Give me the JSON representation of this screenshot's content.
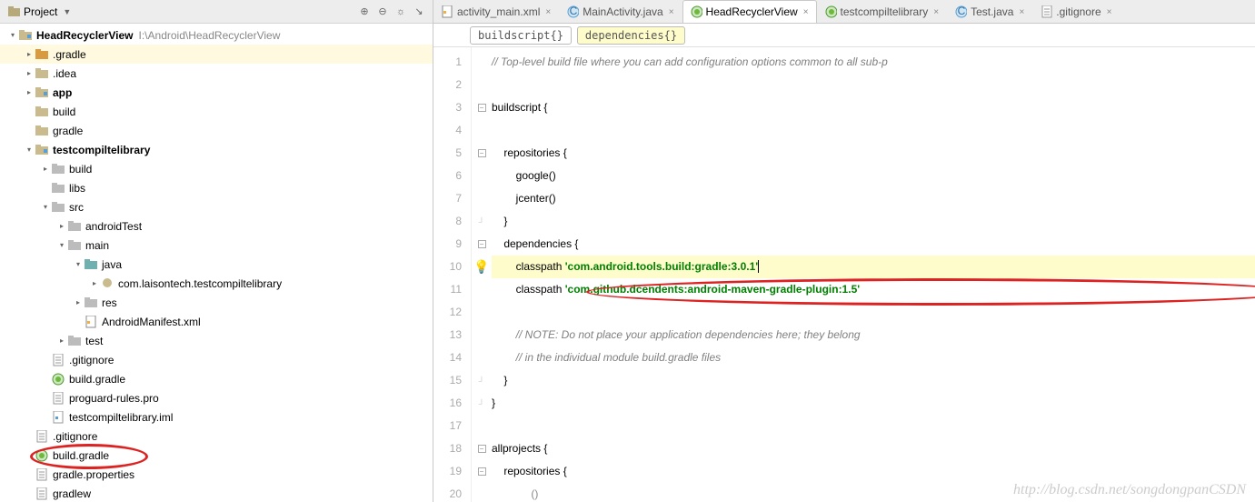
{
  "panel": {
    "title": "Project",
    "root_name": "HeadRecyclerView",
    "root_path": "I:\\Android\\HeadRecyclerView"
  },
  "tree": [
    {
      "depth": 0,
      "arrow": "down",
      "icon": "module",
      "label": "HeadRecyclerView",
      "bold": true,
      "path": "I:\\Android\\HeadRecyclerView"
    },
    {
      "depth": 1,
      "arrow": "right",
      "icon": "folder-orange",
      "label": ".gradle",
      "selected": true
    },
    {
      "depth": 1,
      "arrow": "right",
      "icon": "folder",
      "label": ".idea"
    },
    {
      "depth": 1,
      "arrow": "right",
      "icon": "module",
      "label": "app",
      "bold": true
    },
    {
      "depth": 1,
      "arrow": "",
      "icon": "folder",
      "label": "build"
    },
    {
      "depth": 1,
      "arrow": "",
      "icon": "folder",
      "label": "gradle"
    },
    {
      "depth": 1,
      "arrow": "down",
      "icon": "module",
      "label": "testcompiltelibrary",
      "bold": true
    },
    {
      "depth": 2,
      "arrow": "right",
      "icon": "folder-gray",
      "label": "build"
    },
    {
      "depth": 2,
      "arrow": "",
      "icon": "folder-gray",
      "label": "libs"
    },
    {
      "depth": 2,
      "arrow": "down",
      "icon": "folder-gray",
      "label": "src"
    },
    {
      "depth": 3,
      "arrow": "right",
      "icon": "folder-gray",
      "label": "androidTest"
    },
    {
      "depth": 3,
      "arrow": "down",
      "icon": "folder-gray",
      "label": "main"
    },
    {
      "depth": 4,
      "arrow": "down",
      "icon": "folder-teal",
      "label": "java"
    },
    {
      "depth": 5,
      "arrow": "right",
      "icon": "package",
      "label": "com.laisontech.testcompiltelibrary"
    },
    {
      "depth": 4,
      "arrow": "right",
      "icon": "folder-gray",
      "label": "res"
    },
    {
      "depth": 4,
      "arrow": "",
      "icon": "xml",
      "label": "AndroidManifest.xml"
    },
    {
      "depth": 3,
      "arrow": "right",
      "icon": "folder-gray",
      "label": "test"
    },
    {
      "depth": 2,
      "arrow": "",
      "icon": "file",
      "label": ".gitignore"
    },
    {
      "depth": 2,
      "arrow": "",
      "icon": "gradle",
      "label": "build.gradle"
    },
    {
      "depth": 2,
      "arrow": "",
      "icon": "file",
      "label": "proguard-rules.pro"
    },
    {
      "depth": 2,
      "arrow": "",
      "icon": "iml",
      "label": "testcompiltelibrary.iml"
    },
    {
      "depth": 1,
      "arrow": "",
      "icon": "file",
      "label": ".gitignore"
    },
    {
      "depth": 1,
      "arrow": "",
      "icon": "gradle",
      "label": "build.gradle"
    },
    {
      "depth": 1,
      "arrow": "",
      "icon": "file",
      "label": "gradle.properties"
    },
    {
      "depth": 1,
      "arrow": "",
      "icon": "file",
      "label": "gradlew"
    }
  ],
  "tabs": [
    {
      "icon": "xml",
      "label": "activity_main.xml",
      "active": false
    },
    {
      "icon": "java",
      "label": "MainActivity.java",
      "active": false
    },
    {
      "icon": "gradle",
      "label": "HeadRecyclerView",
      "active": true
    },
    {
      "icon": "gradle",
      "label": "testcompiltelibrary",
      "active": false
    },
    {
      "icon": "java",
      "label": "Test.java",
      "active": false
    },
    {
      "icon": "file",
      "label": ".gitignore",
      "active": false
    }
  ],
  "breadcrumb": [
    {
      "text": "buildscript{}",
      "active": false
    },
    {
      "text": "dependencies{}",
      "active": true
    }
  ],
  "code": {
    "lines": [
      {
        "n": 1,
        "html": "<span class='comment'>// Top-level build file where you can add configuration options common to all sub-p</span>"
      },
      {
        "n": 2,
        "html": ""
      },
      {
        "n": 3,
        "html": "buildscript {",
        "fold": "open"
      },
      {
        "n": 4,
        "html": ""
      },
      {
        "n": 5,
        "html": "    repositories {",
        "fold": "open"
      },
      {
        "n": 6,
        "html": "        google()"
      },
      {
        "n": 7,
        "html": "        jcenter()"
      },
      {
        "n": 8,
        "html": "    }",
        "fold": "close"
      },
      {
        "n": 9,
        "html": "    dependencies {",
        "fold": "open"
      },
      {
        "n": 10,
        "html": "        classpath <span class='string'>'com.android.tools.build:gradle:3.0.1'</span><span class='caret'></span>",
        "hl": true,
        "bulb": true
      },
      {
        "n": 11,
        "html": "        classpath <span class='string'>'com.github.dcendents:android-maven-gradle-plugin:1.5'</span>"
      },
      {
        "n": 12,
        "html": ""
      },
      {
        "n": 13,
        "html": "        <span class='comment'>// NOTE: Do not place your application dependencies here; they belong</span>"
      },
      {
        "n": 14,
        "html": "        <span class='comment'>// in the individual module build.gradle files</span>"
      },
      {
        "n": 15,
        "html": "    }",
        "fold": "close"
      },
      {
        "n": 16,
        "html": "}",
        "fold": "close"
      },
      {
        "n": 17,
        "html": ""
      },
      {
        "n": 18,
        "html": "allprojects {",
        "fold": "open"
      },
      {
        "n": 19,
        "html": "    repositories {",
        "fold": "open"
      },
      {
        "n": 20,
        "html": "             <span style='color:#888'>()</span>"
      }
    ]
  },
  "watermark": "http://blog.csdn.net/songdongpanCSDN"
}
